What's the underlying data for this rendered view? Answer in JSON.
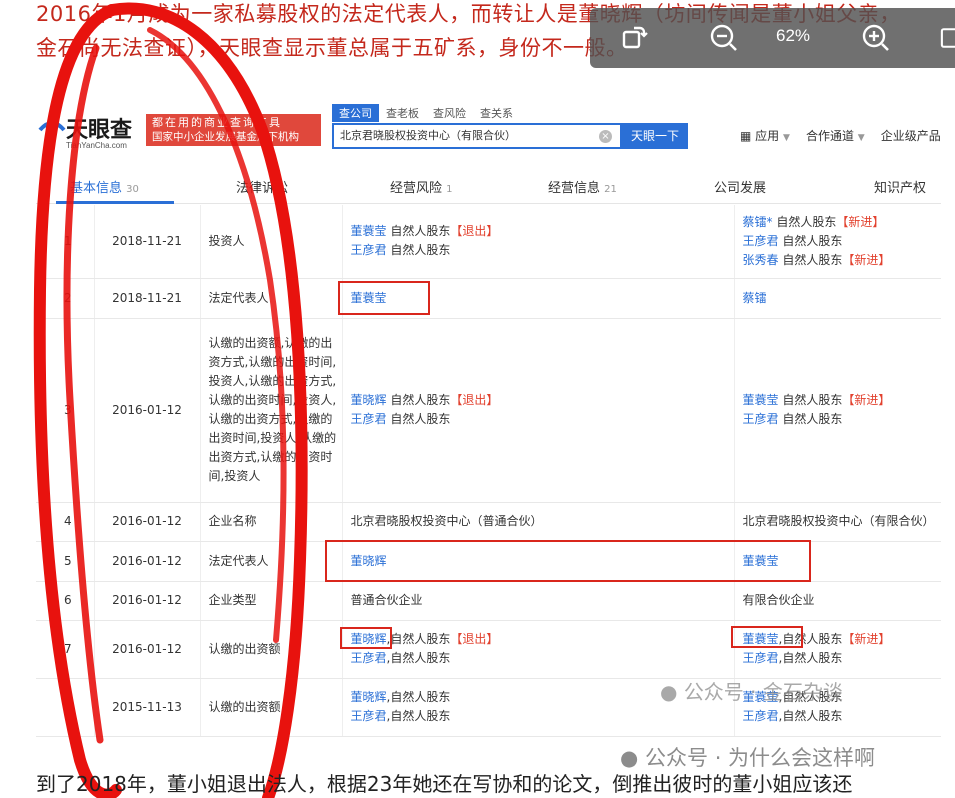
{
  "article": {
    "top_line1": "2016年1月成为一家私募股权的法定代表人，而转让人是董晓辉（坊间传闻是董小姐父亲，",
    "top_line2": "金石尚无法查证），天眼查显示董总属于五矿系，身份不一般。",
    "bottom_line": "到了2018年，董小姐退出法人，根据23年她还在写协和的论文，倒推出彼时的董小姐应该还"
  },
  "viewer": {
    "zoom": "62%",
    "icons": [
      "rotate-icon",
      "zoom-out-icon",
      "zoom-in-icon",
      "panel-icon"
    ]
  },
  "tianyancha": {
    "logo_text": "天眼查",
    "logo_sub": "TianYanCha.com",
    "slogan_line1": "都在用的商业查询工具",
    "slogan_line2": "国家中小企业发展基金旗下机构",
    "search_tabs": [
      "查公司",
      "查老板",
      "查风险",
      "查关系"
    ],
    "search_value": "北京君晓股权投资中心（有限合伙）",
    "search_button": "天眼一下",
    "header_links": [
      "应用",
      "合作通道",
      "企业级产品"
    ],
    "nav": [
      {
        "label": "基本信息",
        "count": "30"
      },
      {
        "label": "法律诉讼",
        "count": ""
      },
      {
        "label": "经营风险",
        "count": "1"
      },
      {
        "label": "经营信息",
        "count": "21"
      },
      {
        "label": "公司发展",
        "count": ""
      },
      {
        "label": "知识产权",
        "count": ""
      }
    ]
  },
  "rows": [
    {
      "no": "1",
      "date": "2018-11-21",
      "item": "投资人",
      "before": [
        [
          "董蓑莹",
          "自然人股东",
          "【退出】"
        ],
        [
          "王彦君",
          "自然人股东",
          ""
        ]
      ],
      "after": [
        [
          "蔡镭*",
          "自然人股东",
          "【新进】"
        ],
        [
          "王彦君",
          "自然人股东",
          ""
        ],
        [
          "张秀春",
          "自然人股东",
          "【新进】"
        ]
      ]
    },
    {
      "no": "2",
      "date": "2018-11-21",
      "item": "法定代表人",
      "before": [
        [
          "董蓑莹",
          "",
          ""
        ]
      ],
      "after": [
        [
          "蔡镭",
          "",
          ""
        ]
      ]
    },
    {
      "no": "3",
      "date": "2016-01-12",
      "item": "认缴的出资额,认缴的出资方式,认缴的出资时间,投资人,认缴的出资方式,认缴的出资时间,投资人,认缴的出资方式,认缴的出资时间,投资人,认缴的出资方式,认缴的出资时间,投资人",
      "before": [
        [
          "董晓辉",
          "自然人股东",
          "【退出】"
        ],
        [
          "王彦君",
          "自然人股东",
          ""
        ]
      ],
      "after": [
        [
          "董蓑莹",
          "自然人股东",
          "【新进】"
        ],
        [
          "王彦君",
          "自然人股东",
          ""
        ]
      ]
    },
    {
      "no": "4",
      "date": "2016-01-12",
      "item": "企业名称",
      "before_text": "北京君晓股权投资中心（普通合伙）",
      "after_text": "北京君晓股权投资中心（有限合伙）"
    },
    {
      "no": "5",
      "date": "2016-01-12",
      "item": "法定代表人",
      "before": [
        [
          "董晓辉",
          "",
          ""
        ]
      ],
      "after": [
        [
          "董蓑莹",
          "",
          ""
        ]
      ]
    },
    {
      "no": "6",
      "date": "2016-01-12",
      "item": "企业类型",
      "before_text": "普通合伙企业",
      "after_text": "有限合伙企业"
    },
    {
      "no": "7",
      "date": "2016-01-12",
      "item": "认缴的出资额",
      "before": [
        [
          "董晓辉",
          ",自然人股东",
          "【退出】"
        ],
        [
          "王彦君",
          ",自然人股东",
          ""
        ]
      ],
      "after": [
        [
          "董蓑莹",
          ",自然人股东",
          "【新进】"
        ],
        [
          "王彦君",
          ",自然人股东",
          ""
        ]
      ]
    },
    {
      "no": "",
      "date": "2015-11-13",
      "item": "认缴的出资额",
      "before": [
        [
          "董晓辉",
          ",自然人股东",
          ""
        ],
        [
          "王彦君",
          ",自然人股东",
          ""
        ]
      ],
      "after": [
        [
          "董蓑莹",
          ",自然人股东",
          ""
        ],
        [
          "王彦君",
          ",自然人股东",
          ""
        ]
      ]
    }
  ],
  "watermarks": {
    "inner": "公众号 · 金石杂谈",
    "outer": "公众号 · 为什么会这样啊"
  },
  "colors": {
    "brand_blue": "#2a6fd6",
    "annotation_red": "#d9261c",
    "tag_red": "#e2412e"
  }
}
